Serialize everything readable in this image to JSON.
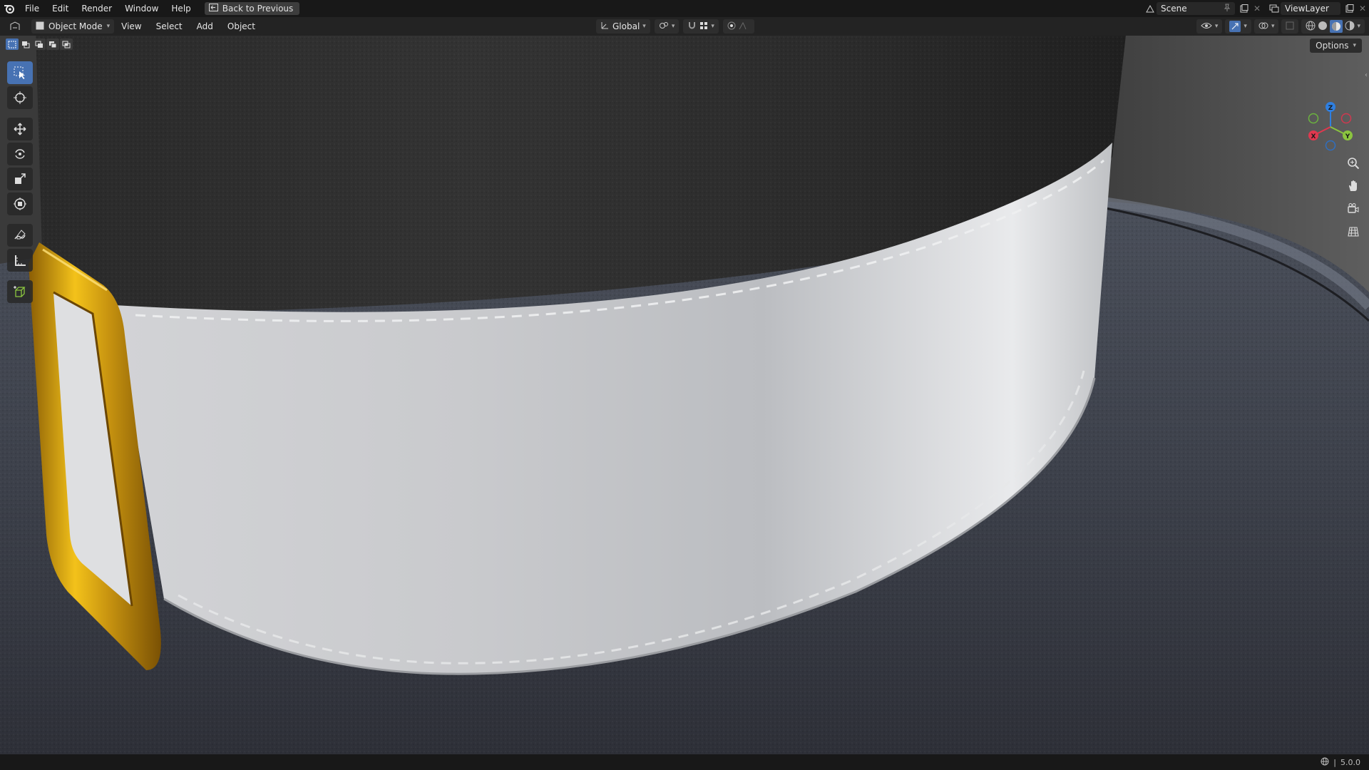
{
  "topbar": {
    "menus": [
      "File",
      "Edit",
      "Render",
      "Window",
      "Help"
    ],
    "back_button": "Back to Previous",
    "scene_label": "Scene",
    "viewlayer_label": "ViewLayer"
  },
  "header": {
    "mode": "Object Mode",
    "menus": [
      "View",
      "Select",
      "Add",
      "Object"
    ],
    "transform_orientation": "Global"
  },
  "viewport": {
    "options_label": "Options",
    "gizmo_axes": [
      "Z",
      "X",
      "Y"
    ]
  },
  "statusbar": {
    "version": "5.0.0"
  },
  "colors": {
    "accent": "#4772b3",
    "axis_x": "#e0384f",
    "axis_y": "#8bc53f",
    "axis_z": "#2f7fe0",
    "buckle_gold": "#d4a017",
    "ribbon_white": "#e8e8ea"
  }
}
